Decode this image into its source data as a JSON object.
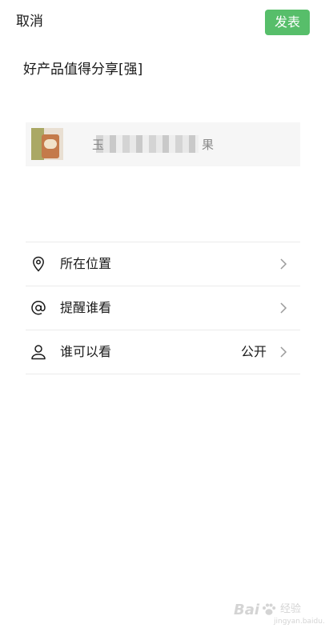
{
  "header": {
    "cancel_label": "取消",
    "publish_label": "发表"
  },
  "post": {
    "text": "好产品值得分享[强]"
  },
  "share_card": {
    "title_first_char": "玉",
    "title_last_char": "果"
  },
  "options": [
    {
      "label": "所在位置",
      "value": "",
      "icon": "location-pin-icon"
    },
    {
      "label": "提醒谁看",
      "value": "",
      "icon": "at-icon"
    },
    {
      "label": "谁可以看",
      "value": "公开",
      "icon": "person-icon"
    }
  ],
  "watermark": {
    "brand": "Bai",
    "sub": "经验",
    "url": "jingyan.baidu.com"
  },
  "colors": {
    "accent": "#57be6a",
    "card_background": "#f6f6f6",
    "divider": "#ebebeb"
  }
}
